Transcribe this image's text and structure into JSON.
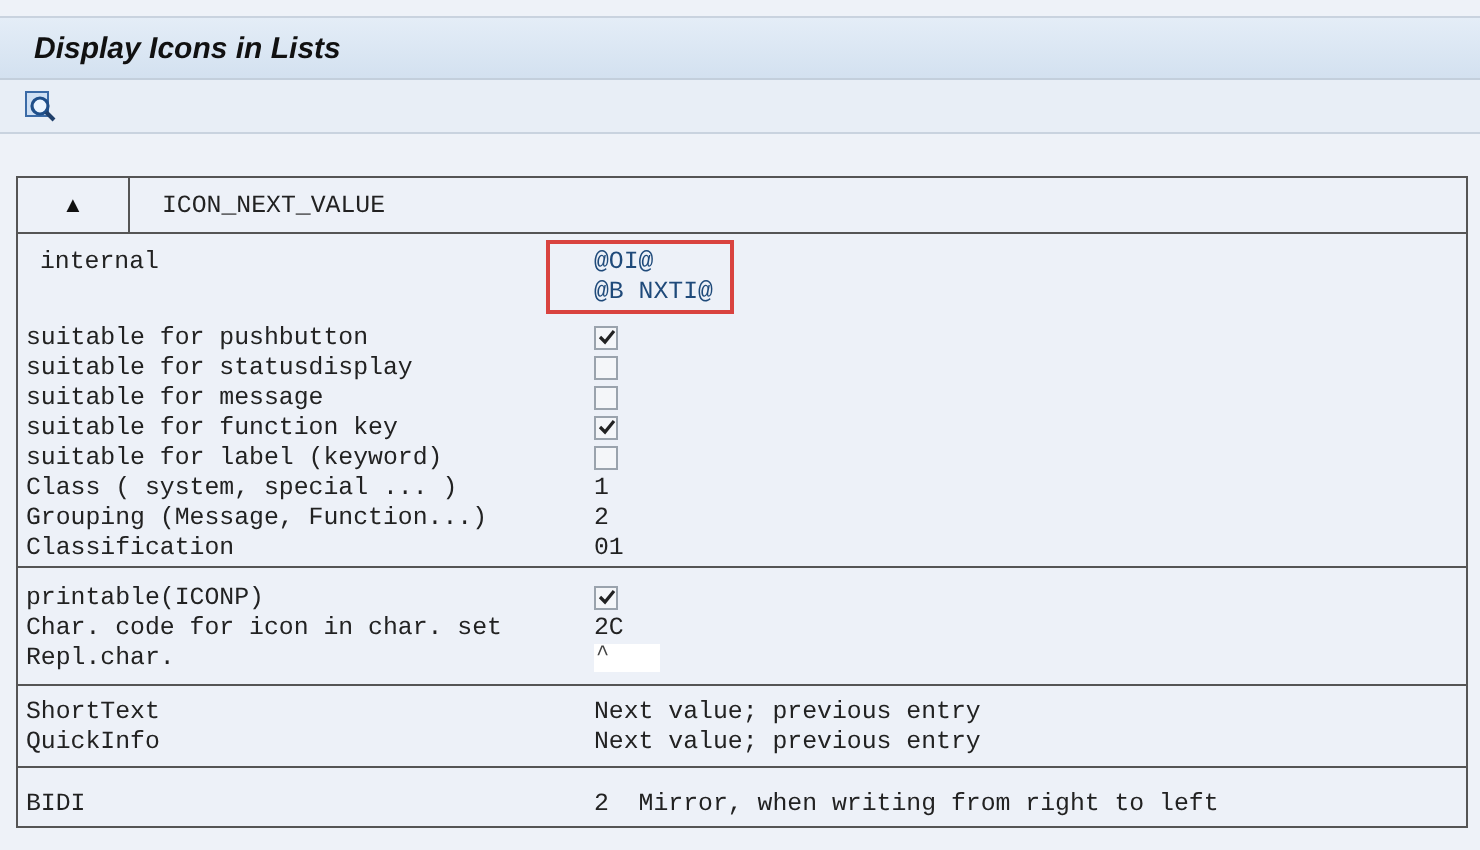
{
  "window": {
    "title": "Display Icons in Lists"
  },
  "toolbar": {
    "buttons": [
      {
        "kind": "search-doc"
      }
    ]
  },
  "header": {
    "toggle": "▲",
    "name": "ICON_NEXT_VALUE"
  },
  "sections": [
    {
      "rows": [
        {
          "kind": "multi",
          "label": "internal",
          "values": [
            "@OI@",
            "@B NXTI@"
          ],
          "highlighted": true
        },
        {
          "kind": "check",
          "label": "suitable for pushbutton",
          "checked": true
        },
        {
          "kind": "check",
          "label": "suitable for statusdisplay",
          "checked": false
        },
        {
          "kind": "check",
          "label": "suitable for message",
          "checked": false
        },
        {
          "kind": "check",
          "label": "suitable for function key",
          "checked": true
        },
        {
          "kind": "check",
          "label": "suitable for label (keyword)",
          "checked": false
        },
        {
          "kind": "text",
          "label": "Class ( system, special ... )",
          "value": "1"
        },
        {
          "kind": "text",
          "label": "Grouping (Message, Function...)",
          "value": "2"
        },
        {
          "kind": "text",
          "label": "Classification",
          "value": "01"
        }
      ]
    },
    {
      "rows": [
        {
          "kind": "check",
          "label": "printable(ICONP)",
          "checked": true
        },
        {
          "kind": "text",
          "label": "Char. code for icon in char. set",
          "value": "2C"
        },
        {
          "kind": "field",
          "label": "Repl.char.",
          "value": "^"
        }
      ]
    },
    {
      "rows": [
        {
          "kind": "text",
          "label": "ShortText",
          "value": "Next value; previous entry"
        },
        {
          "kind": "text",
          "label": "QuickInfo",
          "value": "Next value; previous entry"
        }
      ]
    },
    {
      "rows": [
        {
          "kind": "text",
          "label": "BIDI",
          "value": "2  Mirror, when writing from right to left"
        }
      ]
    }
  ]
}
